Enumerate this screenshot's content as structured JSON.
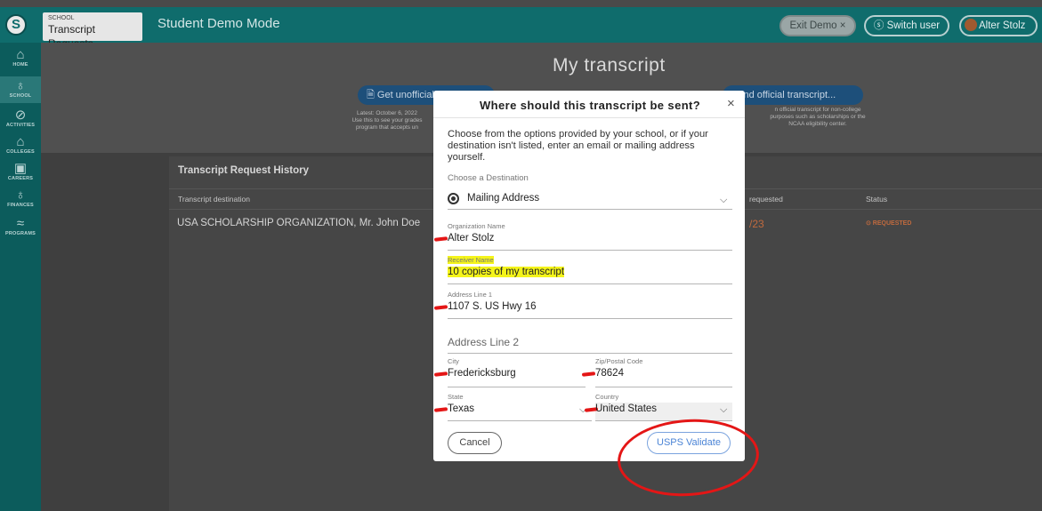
{
  "topbar": {
    "logo_glyph": "S",
    "school_caption": "SCHOOL",
    "school_tab_label": "Transcript Requests",
    "mode_title": "Student Demo Mode",
    "exit_demo_label": "Exit Demo ×",
    "switch_user_label": "ⓢ Switch user",
    "user_name": "Alter Stolz"
  },
  "rail": {
    "items": [
      {
        "label": "HOME",
        "icon": "⌂"
      },
      {
        "label": "SCHOOL",
        "icon": "♁"
      },
      {
        "label": "ACTIVITIES",
        "icon": "⊘"
      },
      {
        "label": "COLLEGES",
        "icon": "⌂"
      },
      {
        "label": "CAREERS",
        "icon": "▣"
      },
      {
        "label": "FINANCES",
        "icon": "♁"
      },
      {
        "label": "PROGRAMS",
        "icon": "≈"
      }
    ]
  },
  "page": {
    "heading": "My transcript",
    "unofficial_btn": "🗎 Get unofficial",
    "unofficial_note_1": "Latest: October 6, 2022",
    "unofficial_note_2": "Use this to see your grades",
    "unofficial_note_3": "program that accepts un",
    "official_btn": "Send official transcript...",
    "official_note_1": "n official transcript for non-college",
    "official_note_2": "purposes such as scholarships or the",
    "official_note_3": "NCAA eligibility center."
  },
  "history": {
    "title": "Transcript Request History",
    "col_destination": "Transcript destination",
    "col_requested": "requested",
    "col_status": "Status",
    "row_destination": "USA SCHOLARSHIP ORGANIZATION, Mr. John Doe",
    "row_date": "/23",
    "row_status": "⊙ REQUESTED"
  },
  "modal": {
    "title": "Where should this transcript be sent?",
    "close_glyph": "×",
    "intro": "Choose from the options provided by your school, or if your destination isn't listed, enter an email or mailing address yourself.",
    "choose_label": "Choose a Destination",
    "destination_value": "Mailing Address",
    "org_label": "Organization Name",
    "org_value": "Alter Stolz",
    "receiver_label": "Receiver Name",
    "receiver_value": "10 copies of my transcript",
    "addr1_label": "Address Line 1",
    "addr1_value": "1107 S. US Hwy 16",
    "addr2_placeholder": "Address Line 2",
    "city_label": "City",
    "city_value": "Fredericksburg",
    "zip_label": "Zip/Postal Code",
    "zip_value": "78624",
    "state_label": "State",
    "state_value": "Texas",
    "country_label": "Country",
    "country_value": "United States",
    "cancel_label": "Cancel",
    "validate_label": "USPS Validate",
    "chevron_glyph": "⌵"
  },
  "colors": {
    "topbar": "#0f6c6c",
    "rail": "#0c5c5c",
    "highlight": "#f4f41a",
    "annotation_red": "#e41616",
    "validate_blue": "#4b84d6"
  }
}
